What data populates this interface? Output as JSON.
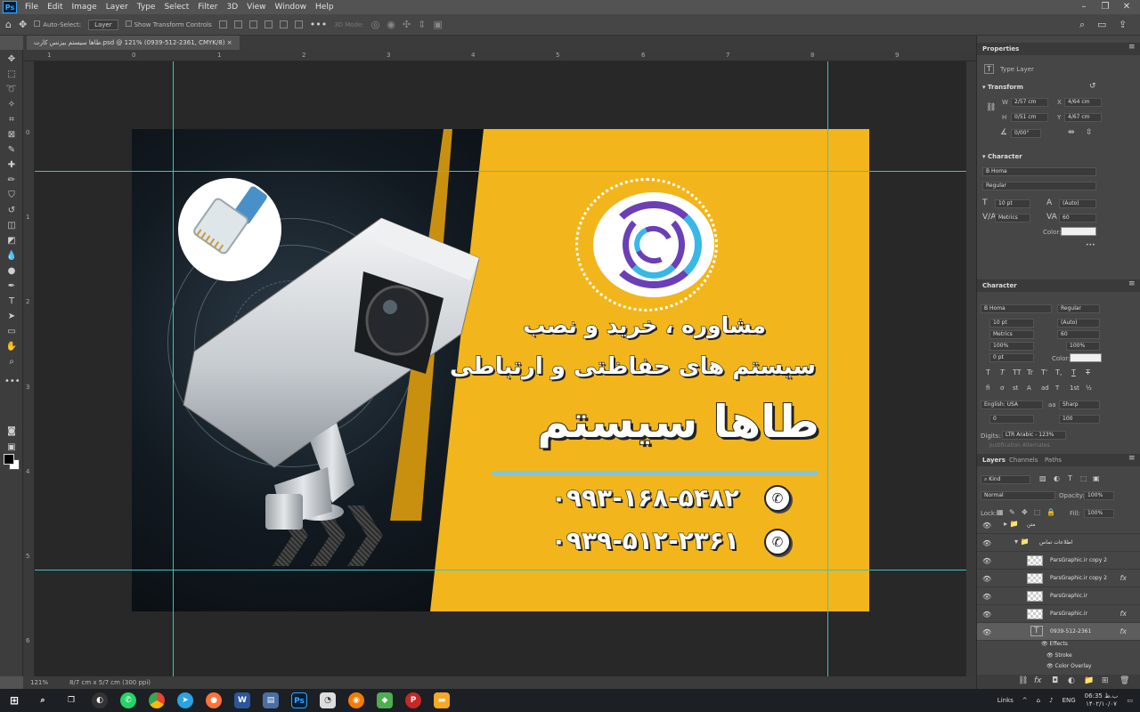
{
  "menubar": {
    "app_icon": "Ps",
    "items": [
      "File",
      "Edit",
      "Image",
      "Layer",
      "Type",
      "Select",
      "Filter",
      "3D",
      "View",
      "Window",
      "Help"
    ]
  },
  "options": {
    "auto_select_label": "Auto-Select:",
    "auto_select_value": "Layer",
    "transform_label": "Show Transform Controls",
    "mode_3d": "3D Mode:"
  },
  "document": {
    "tab_title": "طاها سیستم بیزنس کارت.psd @ 121% (0939-512-2361, CMYK/8)",
    "tab_close": "×",
    "zoom": "121%",
    "doc_size": "8/7 cm x 5/7 cm (300 ppi)"
  },
  "ruler_h": [
    "1",
    "0",
    "1",
    "2",
    "3",
    "4",
    "5",
    "6",
    "7",
    "8",
    "9"
  ],
  "ruler_v": [
    "0",
    "1",
    "2",
    "3",
    "4",
    "5",
    "6"
  ],
  "card": {
    "line1": "مشاوره ، خرید و نصب",
    "line2": "سیستم های حفاظتی و ارتباطی",
    "brand": "طاها سیستم",
    "phone1": "۰۹۹۳-۱۶۸-۵۴۸۲",
    "phone2": "۰۹۳۹-۵۱۲-۲۳۶۱",
    "colors": {
      "yellow": "#f2b51b",
      "dark": "#0e1318",
      "blue_line": "#7fc6d8"
    }
  },
  "properties": {
    "tab": "Properties",
    "layer_type": "Type Layer",
    "transform_title": "Transform",
    "w_label": "W",
    "w_value": "2/57 cm",
    "x_label": "X",
    "x_value": "4/64 cm",
    "h_label": "H",
    "h_value": "0/51 cm",
    "y_label": "Y",
    "y_value": "4/67 cm",
    "angle_value": "0/00°",
    "character_title": "Character",
    "font": "B Homa",
    "style": "Regular",
    "size": "10 pt",
    "leading": "(Auto)",
    "kerning": "Metrics",
    "tracking": "60",
    "color_label": "Color:",
    "more": "•••"
  },
  "character": {
    "tab": "Character",
    "font": "B Homa",
    "style": "Regular",
    "size": "10 pt",
    "leading": "(Auto)",
    "kerning": "Metrics",
    "tracking": "60",
    "vscale": "100%",
    "hscale": "100%",
    "baseline": "0 pt",
    "color_label": "Color:",
    "type_buttons": [
      "T",
      "T",
      "TT",
      "Tr",
      "T'",
      "T,",
      "T",
      "T"
    ],
    "ot_buttons": [
      "fi",
      "ơ",
      "st",
      "A",
      "ad",
      "T",
      "1st",
      "½"
    ],
    "language": "English: USA",
    "aa_label": "aa",
    "antialias": "Sharp",
    "lang_val2": "0",
    "lang_val3": "100",
    "digits_label": "Digits:",
    "digits_value": "LTR Arabic - 123%",
    "justification": "Justification Alternates"
  },
  "layers": {
    "tabs": [
      "Layers",
      "Channels",
      "Paths"
    ],
    "kind": "Kind",
    "blend": "Normal",
    "opacity_label": "Opacity:",
    "opacity": "100%",
    "lock_label": "Lock:",
    "fill_label": "Fill:",
    "fill": "100%",
    "items": [
      {
        "name": "متن",
        "type": "group"
      },
      {
        "name": "اطلاعات تماس",
        "type": "group"
      },
      {
        "name": "ParsGraphic.ir copy 2",
        "fx": ""
      },
      {
        "name": "ParsGraphic.ir copy 2",
        "fx": "fx"
      },
      {
        "name": "ParsGraphic.ir",
        "fx": ""
      },
      {
        "name": "ParsGraphic.ir",
        "fx": "fx"
      },
      {
        "name": "0939-512-2361",
        "fx": "fx"
      }
    ],
    "effects_label": "Effects",
    "effect1": "Stroke",
    "effect2": "Color Overlay"
  },
  "taskbar": {
    "links": "Links",
    "lang": "ENG",
    "time": "06:35 ب.ظ",
    "date": "۱۴۰۲/۱۰/۰۷"
  }
}
